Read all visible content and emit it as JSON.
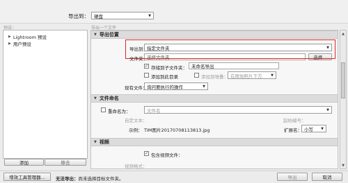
{
  "header": {
    "export_to_label": "导出到：",
    "export_to_value": "硬盘",
    "export_one_file": "导出一个文件",
    "presets_label": "预设："
  },
  "presets": {
    "items": [
      {
        "label": "Lightroom 预设"
      },
      {
        "label": "用户预设"
      }
    ],
    "add_button": "添加",
    "remove_button": "移去"
  },
  "export_location": {
    "title": "导出位置",
    "export_to_label": "导出到：",
    "export_to_value": "指定文件夹",
    "folder_label": "文件夹：",
    "folder_value": "选择文件夹...",
    "choose_button": "选择...",
    "subfolder_label": "存储到子文件夹：",
    "subfolder_value": "未命名导出",
    "subfolder_checked": true,
    "add_to_catalog_label": "添加到此目录",
    "add_to_stack_label": "添加到堆叠：",
    "stack_position": "在原始照片下方",
    "existing_files_label": "现有文件：",
    "existing_files_value": "询问要执行的操作"
  },
  "file_naming": {
    "title": "文件命名",
    "rename_to_label": "重命名为：",
    "rename_to_value": "文件名",
    "custom_text_label": "自定文本：",
    "start_number_label": "起始编号：",
    "example_label": "示例：",
    "example_value": "TIM图片20170708113813.jpg",
    "extension_label": "扩展名：",
    "extension_value": "小写"
  },
  "video": {
    "title": "视频",
    "include_video_label": "包含视频文件：",
    "video_format_label": "视频格式："
  },
  "footer": {
    "plugin_manager": "增效工具管理器...",
    "cannot_export_bold": "无法导出：",
    "cannot_export_text": "尚未选择目标文件夹。",
    "export_button": "导出",
    "cancel_button": "取消"
  }
}
